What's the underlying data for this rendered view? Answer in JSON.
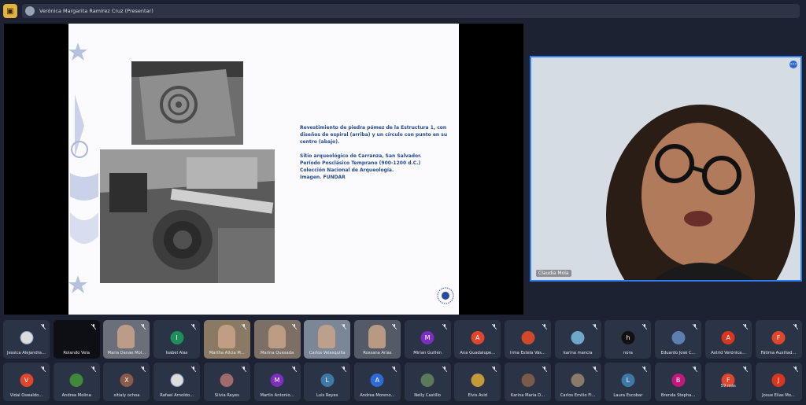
{
  "topbar": {
    "presenter": "Verónica Margarita Ramírez Cruz (Presentar)"
  },
  "slide": {
    "caption_1": "Revestimiento de piedra pómez de la Estructura 1, con diseños de espiral (arriba) y un círculo con punto en su centro (abajo).",
    "caption_2": "Sitio arqueológico de Carranza, San Salvador.",
    "caption_3": "Período Posclásico Temprano (900-1200 d.C.)",
    "caption_4": "Colección Nacional de Arqueología.",
    "caption_5": "Imagen. FUNDAR"
  },
  "speaker": {
    "name": "Claudia Mola",
    "badge": "•••"
  },
  "tiles_row1": [
    {
      "name": "Jessica Alejandra...",
      "initial": "",
      "color": "#dddddd",
      "kind": "logo"
    },
    {
      "name": "Rolando Vela",
      "initial": "",
      "color": "#0d0f14",
      "kind": "dark"
    },
    {
      "name": "María Danae Mol...",
      "initial": "",
      "color": "#6a6f7a",
      "kind": "video"
    },
    {
      "name": "Isabel Alas",
      "initial": "I",
      "color": "#1f8f5a",
      "kind": "avatar"
    },
    {
      "name": "Martha Alicia M...",
      "initial": "",
      "color": "#8a7a64",
      "kind": "video"
    },
    {
      "name": "Marina Quesada",
      "initial": "",
      "color": "#7c6f66",
      "kind": "video"
    },
    {
      "name": "Carlos Velasquilla",
      "initial": "",
      "color": "#7b8796",
      "kind": "video"
    },
    {
      "name": "Rossana Arias",
      "initial": "",
      "color": "#545b67",
      "kind": "video"
    },
    {
      "name": "Mirian Guillén",
      "initial": "M",
      "color": "#7a2fbf",
      "kind": "avatar"
    },
    {
      "name": "Ana Guadalupe...",
      "initial": "A",
      "color": "#e0462b",
      "kind": "avatar"
    },
    {
      "name": "Irma Estela Vás...",
      "initial": "",
      "color": "#d04a2a",
      "kind": "photo"
    },
    {
      "name": "karina mancia",
      "initial": "",
      "color": "#6fa7c9",
      "kind": "photo"
    },
    {
      "name": "nora",
      "initial": "h",
      "color": "#111111",
      "kind": "avatar"
    },
    {
      "name": "Eduardo José C...",
      "initial": "",
      "color": "#5d7fb0",
      "kind": "photo"
    },
    {
      "name": "Astrid Verónica...",
      "initial": "A",
      "color": "#d9361f",
      "kind": "avatar"
    },
    {
      "name": "Fátima Auxiliad...",
      "initial": "F",
      "color": "#e0462b",
      "kind": "avatar"
    }
  ],
  "tiles_row2": [
    {
      "name": "Vidal Oswaldo...",
      "initial": "V",
      "color": "#e0462b",
      "kind": "avatar"
    },
    {
      "name": "Andrea Molina",
      "initial": "",
      "color": "#3e8a3a",
      "kind": "photo"
    },
    {
      "name": "xitialy ochoa",
      "initial": "X",
      "color": "#8a5a4a",
      "kind": "avatar"
    },
    {
      "name": "Rafael Arnoldo...",
      "initial": "",
      "color": "#dddddd",
      "kind": "logo"
    },
    {
      "name": "Silvia Reyes",
      "initial": "",
      "color": "#a06b6b",
      "kind": "photo"
    },
    {
      "name": "Martin Antonio...",
      "initial": "M",
      "color": "#7a2fbf",
      "kind": "avatar"
    },
    {
      "name": "Luis Reyes",
      "initial": "L",
      "color": "#3f78a8",
      "kind": "avatar"
    },
    {
      "name": "Andrea Moreno...",
      "initial": "A",
      "color": "#2f6bd6",
      "kind": "avatar"
    },
    {
      "name": "Nelly Castillo",
      "initial": "",
      "color": "#5a7a5a",
      "kind": "photo"
    },
    {
      "name": "Elvis Avid",
      "initial": "",
      "color": "#c39a3a",
      "kind": "photo"
    },
    {
      "name": "Karina María D...",
      "initial": "",
      "color": "#7a5a48",
      "kind": "photo"
    },
    {
      "name": "Carlos Emilio Fl...",
      "initial": "",
      "color": "#8a7a6a",
      "kind": "photo"
    },
    {
      "name": "Laura Escobar",
      "initial": "L",
      "color": "#3f78a8",
      "kind": "avatar"
    },
    {
      "name": "Brenda Stepha...",
      "initial": "B",
      "color": "#c2187a",
      "kind": "avatar"
    },
    {
      "name": "59 más",
      "initial": "F",
      "color": "#e0462b",
      "kind": "more"
    },
    {
      "name": "Josue Elías Mo...",
      "initial": "J",
      "color": "#d9361f",
      "kind": "avatar"
    }
  ]
}
